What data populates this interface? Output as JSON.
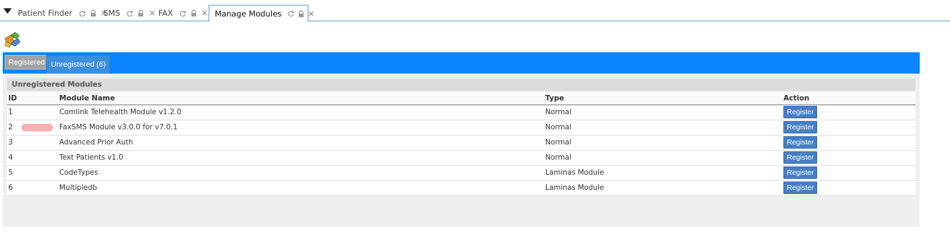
{
  "menu": {
    "icon": "caret-down-icon"
  },
  "tabs": [
    {
      "label": "Patient Finder",
      "active": false
    },
    {
      "label": "SMS",
      "active": false
    },
    {
      "label": "FAX",
      "active": false
    },
    {
      "label": "Manage Modules",
      "active": true
    }
  ],
  "tab_icons": {
    "refresh": "refresh-icon",
    "lock": "lock-icon",
    "close": "close-icon"
  },
  "logo": {
    "icon": "modules-puzzle-icon"
  },
  "subtabs": [
    {
      "label": "Registered",
      "active": false
    },
    {
      "label": "Unregistered (6)",
      "active": true
    }
  ],
  "section_title": "Unregistered Modules",
  "table": {
    "headers": {
      "id": "ID",
      "name": "Module Name",
      "type": "Type",
      "action": "Action"
    },
    "rows": [
      {
        "id": "1",
        "name": "Comlink Telehealth Module v1.2.0",
        "type": "Normal",
        "action": "Register"
      },
      {
        "id": "2",
        "name": "FaxSMS Module v3.0.0 for v7.0.1",
        "type": "Normal",
        "action": "Register"
      },
      {
        "id": "3",
        "name": "Advanced Prior Auth",
        "type": "Normal",
        "action": "Register"
      },
      {
        "id": "4",
        "name": "Text Patients v1.0",
        "type": "Normal",
        "action": "Register"
      },
      {
        "id": "5",
        "name": "CodeTypes",
        "type": "Laminas Module",
        "action": "Register"
      },
      {
        "id": "6",
        "name": "Multipledb",
        "type": "Laminas Module",
        "action": "Register"
      }
    ]
  },
  "colors": {
    "accent": "#0a84ff",
    "button": "#4580c4",
    "tab_border": "#5b9bd5"
  }
}
